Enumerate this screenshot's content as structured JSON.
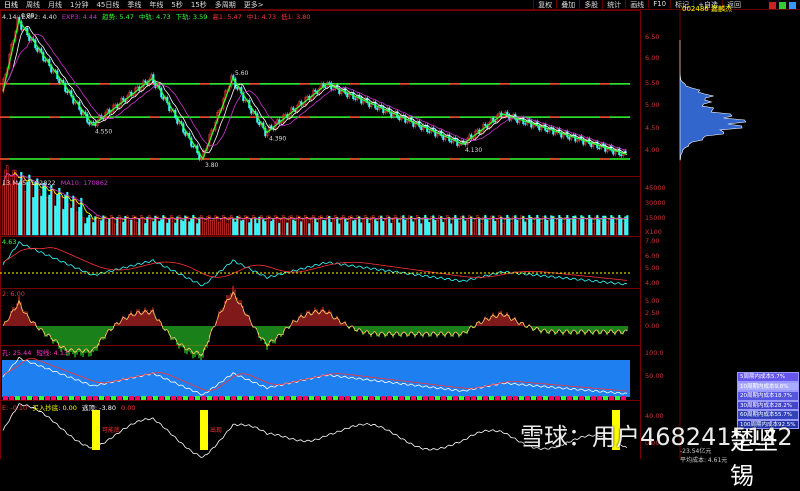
{
  "toolbar": {
    "periods": [
      "日线",
      "周线",
      "月线",
      "1分钟",
      "45日线",
      "季线",
      "年线",
      "5秒",
      "15秒",
      "多周期",
      "更多>"
    ],
    "right": [
      "复权",
      "叠加",
      "多股",
      "统计",
      "画线",
      "F10",
      "标记",
      "+自选",
      "返回"
    ]
  },
  "stock": {
    "code": "002486",
    "name": "嘉麟杰"
  },
  "main_info": [
    {
      "t": "4.14",
      "c": "#ddd"
    },
    {
      "t": "EXP2: 4.40",
      "c": "#ddd"
    },
    {
      "t": "EXP3: 4.44",
      "c": "#c3c"
    },
    {
      "t": "趋势: 5.47",
      "c": "#3f3"
    },
    {
      "t": "中轨: 4.73",
      "c": "#3f3"
    },
    {
      "t": "下轨: 3.59",
      "c": "#3f3"
    },
    {
      "t": "高1: 5.47",
      "c": "#f33"
    },
    {
      "t": "中1: 4.73",
      "c": "#f33"
    },
    {
      "t": "低1: 3.80",
      "c": "#f33"
    }
  ],
  "annotations": {
    "high": "6.88",
    "a": "4.550",
    "b": "5.60",
    "c": "4.390",
    "d": "4.130",
    "low": "3.80"
  },
  "volume_info": [
    {
      "t": "13 MA5: 192822",
      "c": "#ddd"
    },
    {
      "t": "MA10: 170862",
      "c": "#c3c"
    }
  ],
  "p3_info": [
    {
      "t": "4.63",
      "c": "#3f3"
    }
  ],
  "macd_info": [
    {
      "t": "2: 6.00",
      "c": "#f33"
    }
  ],
  "p5_info": [
    {
      "t": "孔: 25.44",
      "c": "#f3c"
    },
    {
      "t": "短线: 4.13",
      "c": "#f3c"
    }
  ],
  "p6_info": [
    {
      "t": "E: -0.10",
      "c": "#f33"
    },
    {
      "t": "买入抄底: 0.00",
      "c": "#ff0"
    },
    {
      "t": "逃顶: -3.80",
      "c": "#fff"
    },
    {
      "t": "0.00",
      "c": "#f33"
    }
  ],
  "p6_marks": [
    "可能底",
    "出现"
  ],
  "axes": {
    "main": [
      "6.50",
      "6.00",
      "5.50",
      "5.00",
      "4.50",
      "4.00"
    ],
    "vol": [
      "45000",
      "30000",
      "15000",
      "X100"
    ],
    "p3": [
      "7.00",
      "6.00",
      "5.00",
      "4.00"
    ],
    "macd": [
      "5.00",
      "2.50",
      "0.00"
    ],
    "p5": [
      "100.0",
      "50.00"
    ],
    "p6": [
      "40.00",
      "0.00"
    ]
  },
  "cost_legend": [
    "5周期内成本5.7%",
    "10周期内成本9.8%",
    "20周期内成本18.7%",
    "30周期内成本28.2%",
    "60周期内成本55.7%",
    "100周期内成本92.5%"
  ],
  "cost_colors": [
    "#6655ee",
    "#aaaaff",
    "#5555dd",
    "#4444cc",
    "#3344bb",
    "#2233aa"
  ],
  "footer": [
    "-23.54亿元",
    "平均成本: 4.61元"
  ],
  "watermark": "雪球：用户4682415142",
  "watermark2": "楚坚锡",
  "chart_data": {
    "type": "candlestick",
    "price_range": [
      3.6,
      7.0
    ],
    "zigzag": [
      [
        0,
        5.3
      ],
      [
        8,
        6.88
      ],
      [
        45,
        4.55
      ],
      [
        75,
        5.6
      ],
      [
        100,
        3.8
      ],
      [
        115,
        5.6
      ],
      [
        132,
        4.39
      ],
      [
        162,
        5.47
      ],
      [
        230,
        4.13
      ],
      [
        250,
        4.8
      ],
      [
        312,
        3.9
      ]
    ],
    "levels": {
      "high": 5.47,
      "mid": 4.73,
      "low": 3.8
    }
  }
}
